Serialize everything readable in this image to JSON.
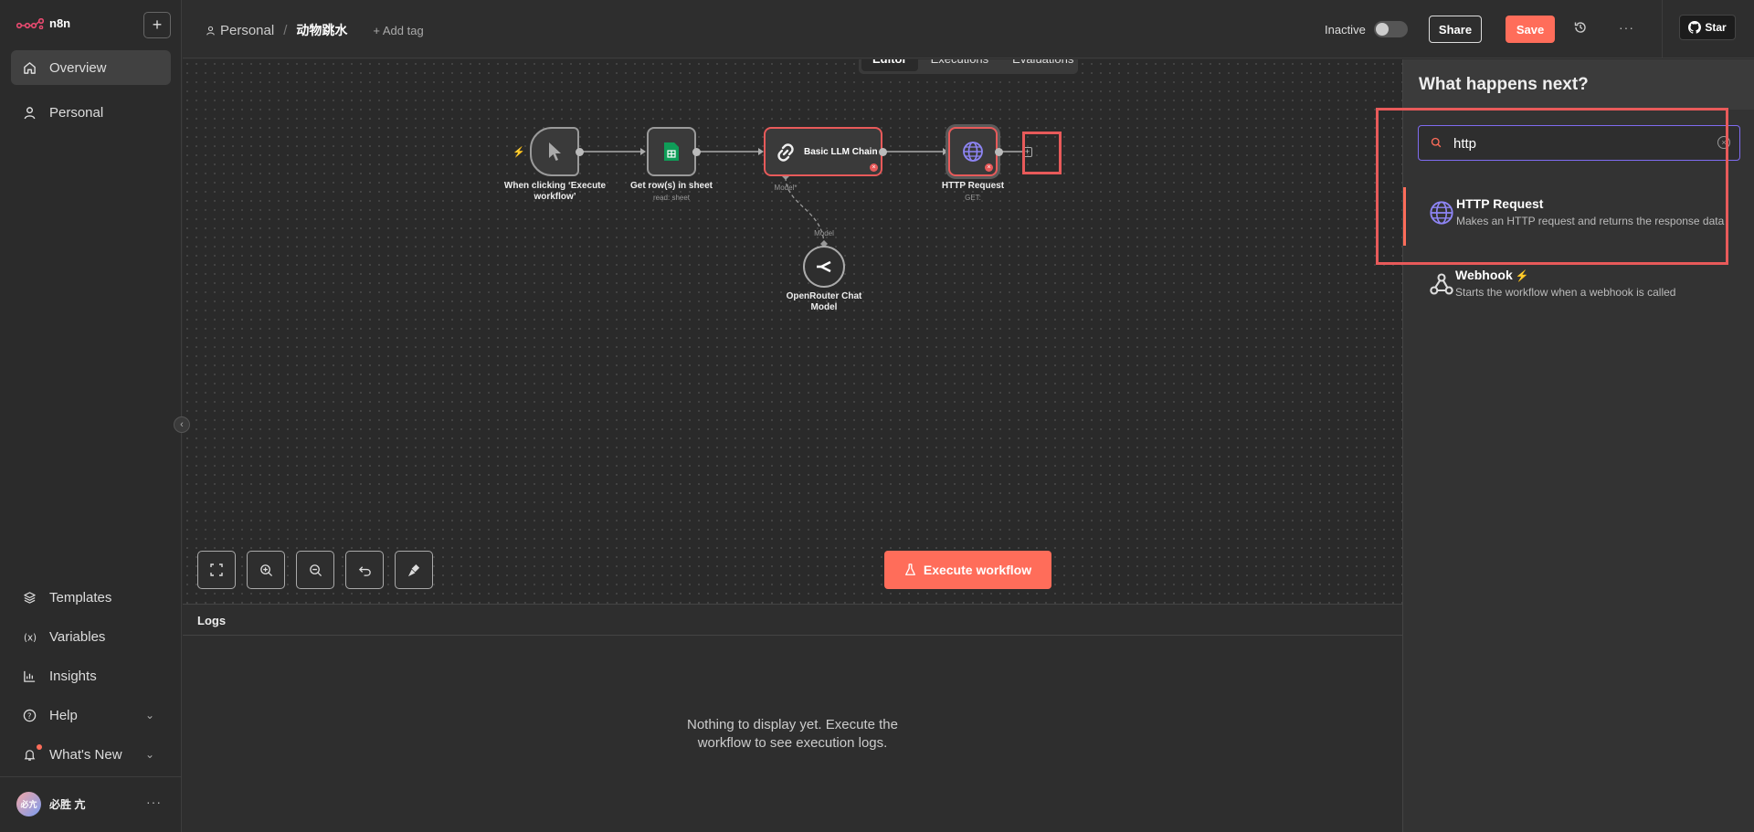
{
  "app": {
    "logo_text": "n8n"
  },
  "sidebar": {
    "top_items": [
      {
        "label": "Overview"
      },
      {
        "label": "Personal"
      }
    ],
    "bottom_items": [
      {
        "label": "Templates"
      },
      {
        "label": "Variables"
      },
      {
        "label": "Insights"
      },
      {
        "label": "Help"
      },
      {
        "label": "What's New"
      }
    ],
    "user": {
      "name": "必胜 亢",
      "avatar_text": "必亢"
    }
  },
  "header": {
    "breadcrumb_project": "Personal",
    "breadcrumb_sep": "/",
    "workflow_title": "动物跳水",
    "add_tag": "+ Add tag",
    "inactive_label": "Inactive",
    "share_label": "Share",
    "save_label": "Save",
    "star_label": "Star"
  },
  "editor_tabs": [
    {
      "label": "Editor",
      "active": true
    },
    {
      "label": "Executions",
      "active": false
    },
    {
      "label": "Evaluations",
      "active": false
    }
  ],
  "nodes": {
    "trigger": {
      "label": "When clicking ‘Execute workflow’"
    },
    "sheet": {
      "label": "Get row(s) in sheet",
      "sub": "read: sheet"
    },
    "llm": {
      "label": "Basic LLM Chain",
      "port_label": "Model*"
    },
    "http": {
      "label": "HTTP Request",
      "sub": "GET:"
    },
    "openrouter": {
      "label": "OpenRouter Chat Model",
      "port_label": "Model"
    }
  },
  "execute_button": "Execute workflow",
  "logs": {
    "title": "Logs",
    "empty_line1": "Nothing to display yet. Execute the",
    "empty_line2": "workflow to see execution logs."
  },
  "panel": {
    "title": "What happens next?",
    "search_value": "http",
    "results": [
      {
        "title": "HTTP Request",
        "desc": "Makes an HTTP request and returns the response data"
      },
      {
        "title": "Webhook",
        "desc": "Starts the workflow when a webhook is called"
      }
    ]
  },
  "colors": {
    "accent": "#ff6d5a",
    "search_border": "#7f6cf0",
    "highlight": "#e85a5a"
  }
}
